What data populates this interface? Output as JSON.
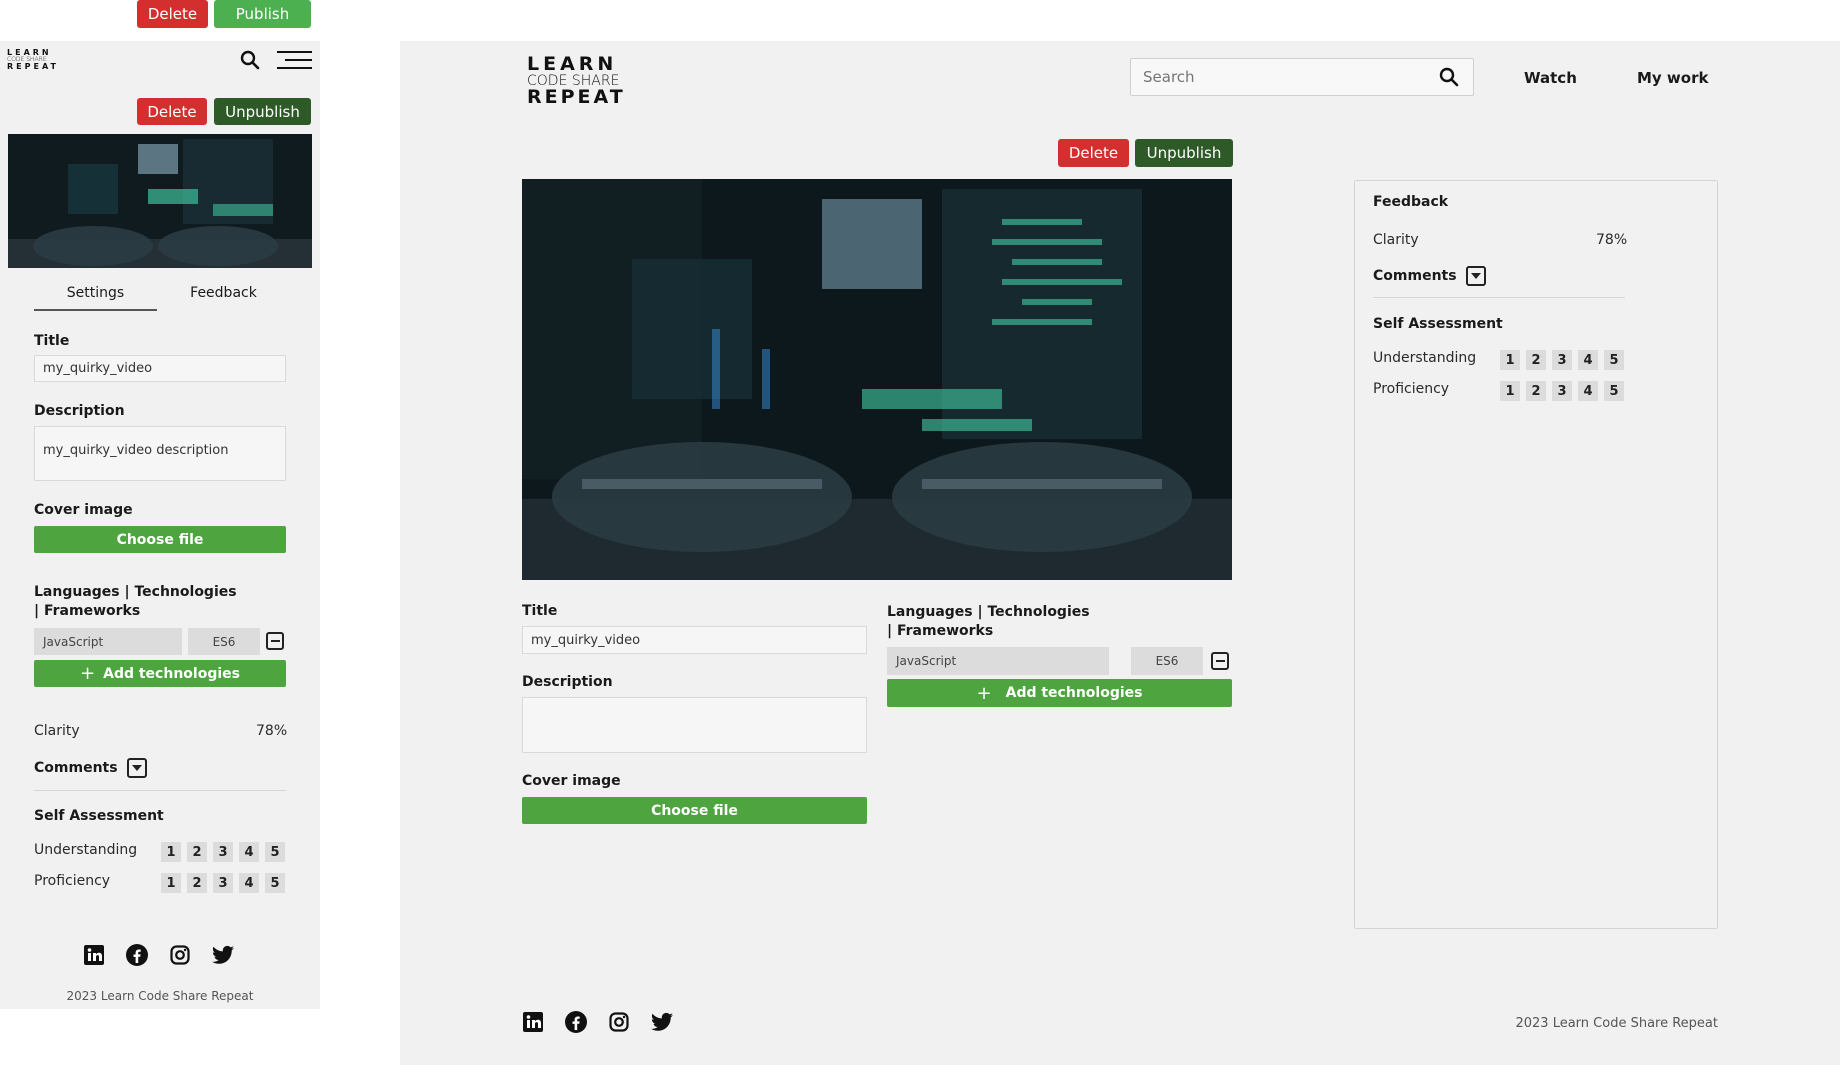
{
  "top_bar": {
    "delete_label": "Delete",
    "publish_label": "Publish"
  },
  "mobile": {
    "logo": {
      "line1": "LEARN",
      "line2": "CODE SHARE",
      "line3": "REPEAT"
    },
    "delete_label": "Delete",
    "unpublish_label": "Unpublish",
    "tabs": [
      {
        "label": "Settings",
        "active": true
      },
      {
        "label": "Feedback",
        "active": false
      }
    ],
    "title_label": "Title",
    "title_value": "my_quirky_video",
    "description_label": "Description",
    "description_value": "my_quirky_video description",
    "cover_label": "Cover image",
    "choose_file_label": "Choose file",
    "tech_label": "Languages | Technologies | Frameworks",
    "tech_tags": [
      "JavaScript",
      "ES6"
    ],
    "add_tech_label": "Add technologies",
    "clarity_label": "Clarity",
    "clarity_value": "78%",
    "comments_label": "Comments",
    "self_assessment_label": "Self Assessment",
    "understanding_label": "Understanding",
    "proficiency_label": "Proficiency",
    "ratings": [
      "1",
      "2",
      "3",
      "4",
      "5"
    ],
    "footer_text": "2023 Learn Code Share Repeat"
  },
  "desktop": {
    "logo": {
      "line1": "LEARN",
      "line2": "CODE SHARE",
      "line3": "REPEAT"
    },
    "search_placeholder": "Search",
    "nav": [
      {
        "label": "Watch"
      },
      {
        "label": "My work"
      }
    ],
    "delete_label": "Delete",
    "unpublish_label": "Unpublish",
    "title_label": "Title",
    "title_value": "my_quirky_video",
    "description_label": "Description",
    "description_value": "",
    "cover_label": "Cover image",
    "choose_file_label": "Choose file",
    "tech_label": "Languages | Technologies | Frameworks",
    "tech_tags": [
      "JavaScript",
      "ES6"
    ],
    "add_tech_label": "Add technologies",
    "feedback": {
      "heading": "Feedback",
      "clarity_label": "Clarity",
      "clarity_value": "78%",
      "comments_label": "Comments",
      "self_assessment_label": "Self Assessment",
      "understanding_label": "Understanding",
      "proficiency_label": "Proficiency",
      "ratings": [
        "1",
        "2",
        "3",
        "4",
        "5"
      ]
    },
    "footer_text": "2023 Learn Code Share Repeat"
  },
  "icons": {
    "social": [
      "linkedin-icon",
      "facebook-icon",
      "instagram-icon",
      "twitter-icon"
    ]
  },
  "colors": {
    "delete": "#d32f2f",
    "publish": "#4caf50",
    "unpublish": "#2e5a27",
    "primary_action": "#4ea53f",
    "panel_bg": "#f1f1f1"
  }
}
